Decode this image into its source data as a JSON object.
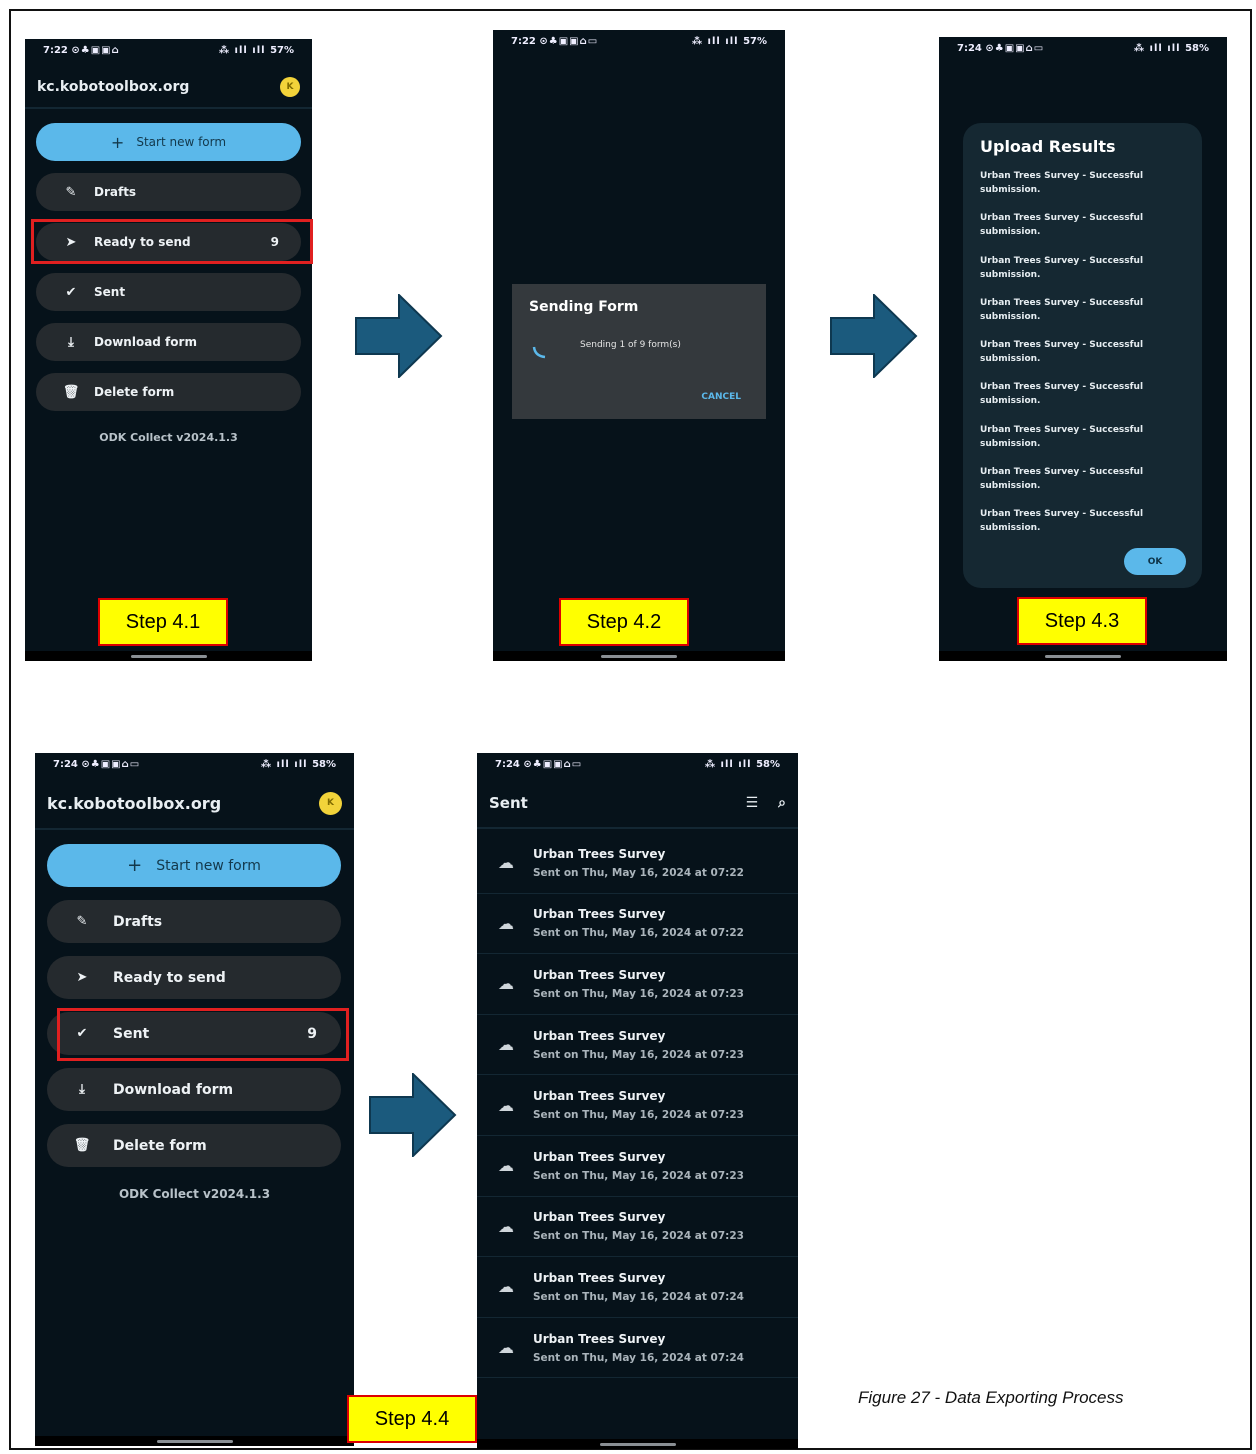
{
  "figure": {
    "caption": "Figure 27 - Data Exporting Process"
  },
  "steps": [
    "Step 4.1",
    "Step 4.2",
    "Step 4.3",
    "Step 4.4"
  ],
  "status": {
    "s1": {
      "time": "7:22",
      "battery": "57%"
    },
    "s2": {
      "time": "7:22",
      "battery": "57%"
    },
    "s3": {
      "time": "7:24",
      "battery": "58%"
    },
    "s4": {
      "time": "7:24",
      "battery": "58%"
    },
    "s5": {
      "time": "7:24",
      "battery": "58%"
    }
  },
  "main_menu": {
    "server": "kc.kobotoolbox.org",
    "avatar_letter": "K",
    "start_new_form": "Start new form",
    "drafts": "Drafts",
    "ready_to_send": "Ready to send",
    "sent": "Sent",
    "download_form": "Download form",
    "delete_form": "Delete form",
    "version": "ODK Collect v2024.1.3",
    "ready_count": "9",
    "sent_count": "9"
  },
  "sending_dialog": {
    "title": "Sending Form",
    "message": "Sending 1 of 9 form(s)",
    "cancel": "CANCEL"
  },
  "upload_results": {
    "title": "Upload Results",
    "items": [
      "Urban Trees Survey - Successful submission.",
      "Urban Trees Survey - Successful submission.",
      "Urban Trees Survey - Successful submission.",
      "Urban Trees Survey - Successful submission.",
      "Urban Trees Survey - Successful submission.",
      "Urban Trees Survey - Successful submission.",
      "Urban Trees Survey - Successful submission.",
      "Urban Trees Survey - Successful submission.",
      "Urban Trees Survey - Successful submission."
    ],
    "ok": "OK"
  },
  "sent_list": {
    "title": "Sent",
    "items": [
      {
        "name": "Urban Trees Survey",
        "detail": "Sent on Thu, May 16, 2024 at 07:22"
      },
      {
        "name": "Urban Trees Survey",
        "detail": "Sent on Thu, May 16, 2024 at 07:22"
      },
      {
        "name": "Urban Trees Survey",
        "detail": "Sent on Thu, May 16, 2024 at 07:23"
      },
      {
        "name": "Urban Trees Survey",
        "detail": "Sent on Thu, May 16, 2024 at 07:23"
      },
      {
        "name": "Urban Trees Survey",
        "detail": "Sent on Thu, May 16, 2024 at 07:23"
      },
      {
        "name": "Urban Trees Survey",
        "detail": "Sent on Thu, May 16, 2024 at 07:23"
      },
      {
        "name": "Urban Trees Survey",
        "detail": "Sent on Thu, May 16, 2024 at 07:23"
      },
      {
        "name": "Urban Trees Survey",
        "detail": "Sent on Thu, May 16, 2024 at 07:24"
      },
      {
        "name": "Urban Trees Survey",
        "detail": "Sent on Thu, May 16, 2024 at 07:24"
      }
    ]
  },
  "colors": {
    "accent": "#5bb8ea",
    "arrow": "#1b5a7d",
    "highlight": "#e02020",
    "step_bg": "#ffff00"
  }
}
